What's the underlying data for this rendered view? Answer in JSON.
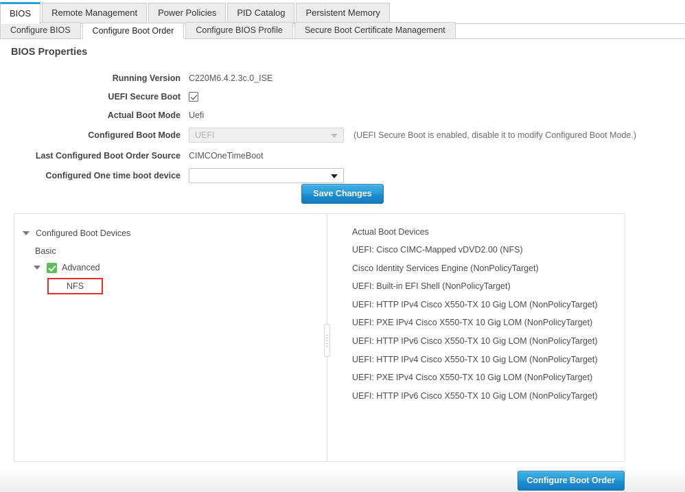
{
  "tabs_primary": [
    {
      "label": "BIOS",
      "active": true
    },
    {
      "label": "Remote Management",
      "active": false
    },
    {
      "label": "Power Policies",
      "active": false
    },
    {
      "label": "PID Catalog",
      "active": false
    },
    {
      "label": "Persistent Memory",
      "active": false
    }
  ],
  "tabs_secondary": [
    {
      "label": "Configure BIOS",
      "active": false
    },
    {
      "label": "Configure Boot Order",
      "active": true
    },
    {
      "label": "Configure BIOS Profile",
      "active": false
    },
    {
      "label": "Secure Boot Certificate Management",
      "active": false
    }
  ],
  "section": {
    "title": "BIOS Properties"
  },
  "properties": {
    "running_version_label": "Running Version",
    "running_version_value": "C220M6.4.2.3c.0_ISE",
    "uefi_secure_boot_label": "UEFI Secure Boot",
    "uefi_secure_boot_checked": "true",
    "actual_boot_mode_label": "Actual Boot Mode",
    "actual_boot_mode_value": "Uefi",
    "configured_boot_mode_label": "Configured Boot Mode",
    "configured_boot_mode_value": "UEFI",
    "configured_boot_mode_hint": "(UEFI Secure Boot is enabled, disable it to modify Configured Boot Mode.)",
    "last_configured_boot_order_source_label": "Last Configured Boot Order Source",
    "last_configured_boot_order_source_value": "CIMCOneTimeBoot",
    "configured_one_time_boot_device_label": "Configured One time boot device",
    "configured_one_time_boot_device_value": ""
  },
  "buttons": {
    "save_changes": "Save Changes",
    "configure_boot_order": "Configure Boot Order"
  },
  "configured_boot_devices": {
    "title": "Configured Boot Devices",
    "basic": "Basic",
    "advanced": "Advanced",
    "selected_device": "NFS"
  },
  "actual_boot_devices": {
    "title": "Actual Boot Devices",
    "items": [
      "UEFI: Cisco CIMC-Mapped vDVD2.00 (NFS)",
      "Cisco Identity Services Engine (NonPolicyTarget)",
      "UEFI: Built-in EFI Shell (NonPolicyTarget)",
      "UEFI: HTTP IPv4 Cisco X550-TX 10 Gig LOM (NonPolicyTarget)",
      "UEFI: PXE IPv4 Cisco X550-TX 10 Gig LOM (NonPolicyTarget)",
      "UEFI: HTTP IPv6 Cisco X550-TX 10 Gig LOM (NonPolicyTarget)",
      "UEFI: HTTP IPv4 Cisco X550-TX 10 Gig LOM (NonPolicyTarget)",
      "UEFI: PXE IPv4 Cisco X550-TX 10 Gig LOM (NonPolicyTarget)",
      "UEFI: HTTP IPv6 Cisco X550-TX 10 Gig LOM (NonPolicyTarget)"
    ]
  },
  "colors": {
    "accent_blue": "#29a0dc",
    "active_tab_border": "#25a1d8",
    "highlight_red": "#ee2a24",
    "check_green": "#5bbd5b"
  }
}
